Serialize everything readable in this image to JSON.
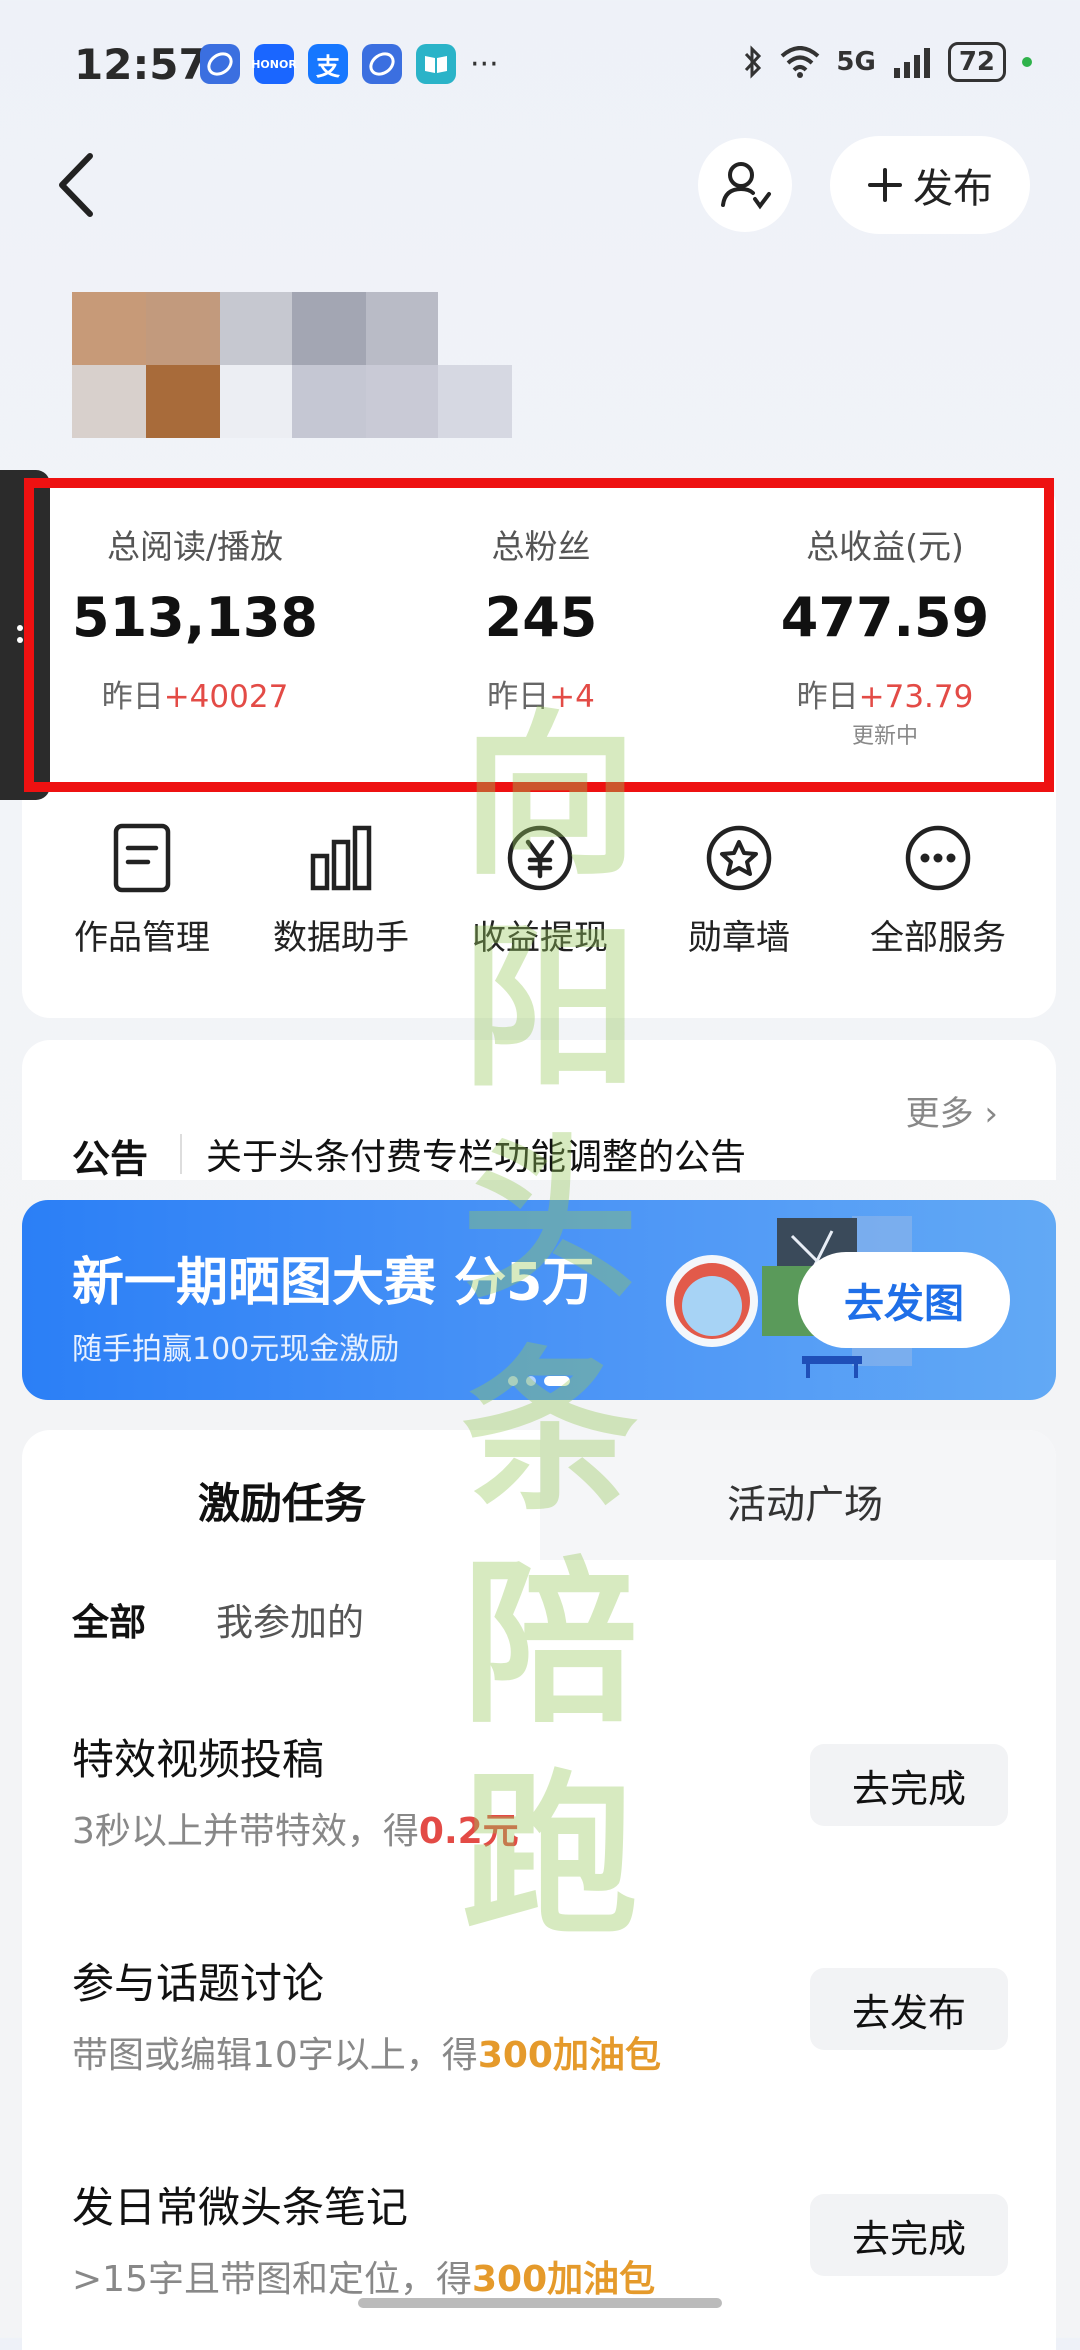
{
  "status_bar": {
    "time": "12:57",
    "app_icons": [
      "browser-icon",
      "honor-icon",
      "alipay-icon",
      "browser-icon",
      "reader-icon"
    ],
    "more": "···",
    "honor_label": "HONOR",
    "alipay_label": "支",
    "network": "5G",
    "battery": "72"
  },
  "header": {
    "publish_label": "发布"
  },
  "stats": [
    {
      "label": "总阅读/播放",
      "value": "513,138",
      "yesterday_prefix": "昨日",
      "yesterday_delta": "+40027",
      "note": ""
    },
    {
      "label": "总粉丝",
      "value": "245",
      "yesterday_prefix": "昨日",
      "yesterday_delta": "+4",
      "note": ""
    },
    {
      "label": "总收益(元)",
      "value": "477.59",
      "yesterday_prefix": "昨日",
      "yesterday_delta": "+73.79",
      "note": "更新中"
    }
  ],
  "services": [
    {
      "label": "作品管理",
      "icon": "document-icon"
    },
    {
      "label": "数据助手",
      "icon": "bar-chart-icon"
    },
    {
      "label": "收益提现",
      "icon": "yen-icon"
    },
    {
      "label": "勋章墙",
      "icon": "badge-icon"
    },
    {
      "label": "全部服务",
      "icon": "more-icon"
    }
  ],
  "notice": {
    "more": "更多",
    "tag": "公告",
    "text": "关于头条付费专栏功能调整的公告"
  },
  "banner": {
    "title": "新一期晒图大赛 分5万",
    "subtitle": "随手拍赢100元现金激励",
    "button": "去发图",
    "accent": "#2b7ff6"
  },
  "tasks": {
    "tabs": [
      "激励任务",
      "活动广场"
    ],
    "filters": [
      "全部",
      "我参加的"
    ],
    "items": [
      {
        "title": "特效视频投稿",
        "desc": "3秒以上并带特效，得",
        "reward": "0.2元",
        "reward_color": "#e34b46",
        "button": "去完成"
      },
      {
        "title": "参与话题讨论",
        "desc": "带图或编辑10字以上，得",
        "reward": "300加油包",
        "reward_color": "#e59a2b",
        "button": "去发布"
      },
      {
        "title": "发日常微头条笔记",
        "desc": ">15字且带图和定位，得",
        "reward": "300加油包",
        "reward_color": "#e59a2b",
        "button": "去完成"
      }
    ]
  },
  "watermark": "向阳头条陪跑",
  "colors": {
    "highlight_frame": "#ee1111",
    "increase": "#e34b46",
    "reward_orange": "#e59a2b"
  }
}
